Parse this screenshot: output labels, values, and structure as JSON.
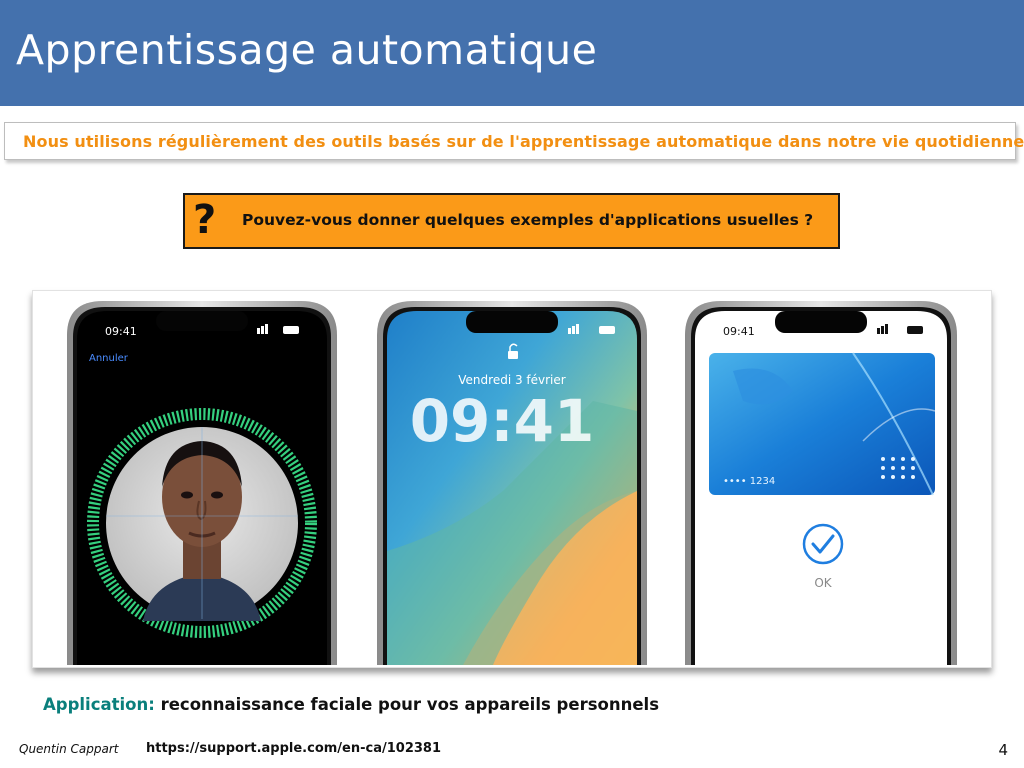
{
  "slide": {
    "title": "Apprentissage automatique",
    "intro": "Nous utilisons régulièrement des outils basés sur de l'apprentissage automatique dans notre vie quotidienne",
    "question_mark": "?",
    "question": "Pouvez-vous donner quelques exemples d'applications usuelles ?",
    "application_label": "Application:",
    "application_text": "reconnaissance faciale pour vos appareils personnels",
    "footer_author": "Quentin Cappart",
    "footer_url": "https://support.apple.com/en-ca/102381",
    "page_number": "4"
  },
  "phones": {
    "phone1": {
      "time": "09:41",
      "cancel": "Annuler"
    },
    "phone2": {
      "date": "Vendredi 3 février",
      "time": "09:41"
    },
    "phone3": {
      "time": "09:41",
      "card_number": "•••• 1234",
      "ok_label": "OK"
    }
  },
  "colors": {
    "title_bar": "#4471ad",
    "intro_text": "#f28f12",
    "question_box": "#fb9a18",
    "application_label": "#0a7f7c",
    "faceid_ring": "#35d07f"
  }
}
